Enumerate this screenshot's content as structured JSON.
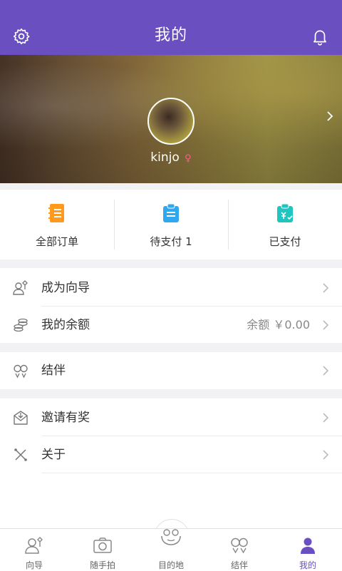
{
  "header": {
    "title": "我的",
    "left_icon": "gear-icon",
    "right_icon": "bell-icon"
  },
  "profile": {
    "username": "kinjo",
    "gender_symbol": "♀",
    "accent": "#ff5a8a"
  },
  "orders": [
    {
      "label": "全部订单",
      "icon": "order-list-icon",
      "color": "#ff9a1f"
    },
    {
      "label": "待支付 1",
      "icon": "pending-payment-icon",
      "color": "#2fa8f0"
    },
    {
      "label": "已支付",
      "icon": "paid-icon",
      "color": "#1fc6c0"
    }
  ],
  "menu": {
    "become_guide": "成为向导",
    "balance": "我的余额",
    "balance_value": "余额 ￥0.00",
    "companion": "结伴",
    "invite": "邀请有奖",
    "about": "关于"
  },
  "tabs": [
    {
      "label": "向导",
      "icon": "guide-icon"
    },
    {
      "label": "随手拍",
      "icon": "camera-icon"
    },
    {
      "label": "目的地",
      "icon": "destination-icon"
    },
    {
      "label": "结伴",
      "icon": "companion-icon"
    },
    {
      "label": "我的",
      "icon": "profile-icon",
      "active": true
    }
  ],
  "colors": {
    "primary": "#6a4fc0",
    "background": "#f2f2f4"
  }
}
